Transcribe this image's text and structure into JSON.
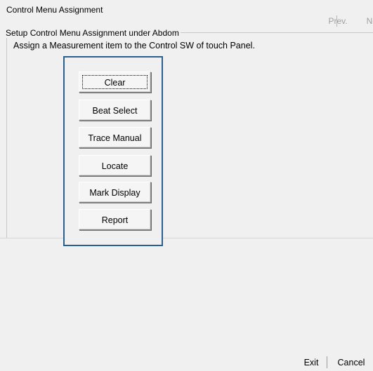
{
  "window": {
    "title": "Control Menu Assignment"
  },
  "nav": {
    "prev_label": "Prev.",
    "next_label": "Next"
  },
  "group": {
    "caption": "Setup Control Menu Assignment under Abdom",
    "instruction": "Assign a Measurement item to the Control SW of touch Panel."
  },
  "menu": {
    "items": [
      {
        "label": "Clear"
      },
      {
        "label": "Beat Select"
      },
      {
        "label": "Trace Manual"
      },
      {
        "label": "Locate"
      },
      {
        "label": "Mark Display"
      },
      {
        "label": "Report"
      }
    ]
  },
  "footer": {
    "exit_label": "Exit",
    "cancel_label": "Cancel"
  },
  "colors": {
    "panel_border": "#2a5f8f",
    "disabled_text": "#a0a0a0",
    "background": "#f0f0f0"
  }
}
